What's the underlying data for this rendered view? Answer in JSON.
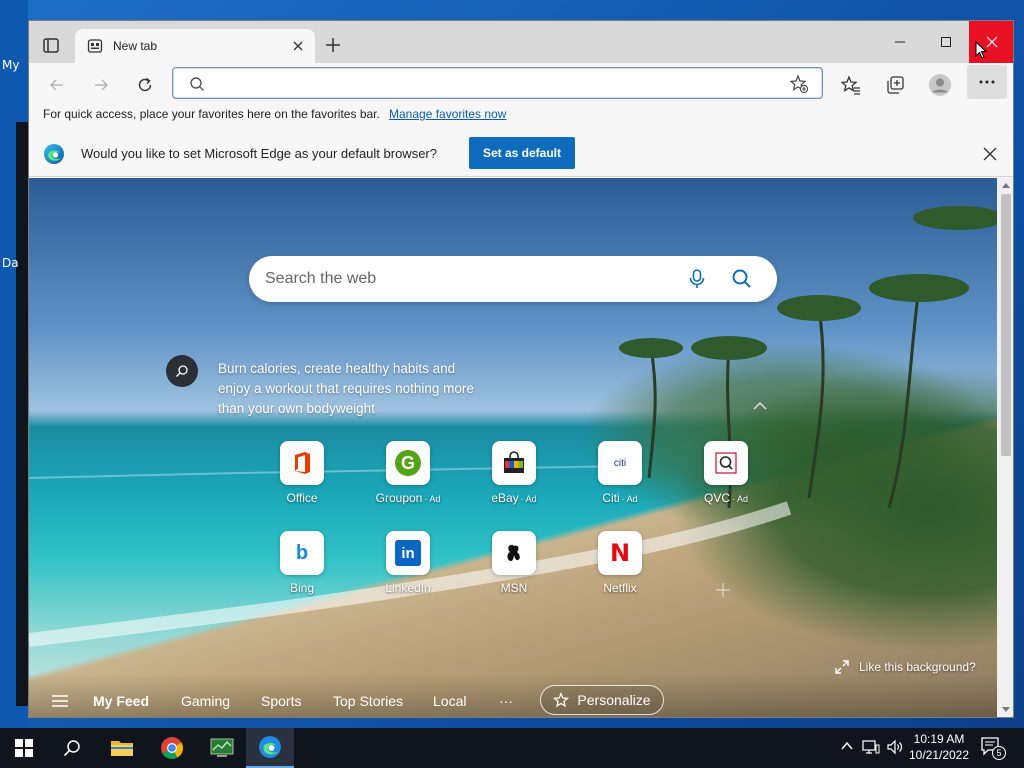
{
  "desktop": {
    "icon_labels": [
      "My",
      "Da"
    ]
  },
  "browser": {
    "tab": {
      "title": "New tab"
    },
    "address_bar": {
      "value": "",
      "placeholder": ""
    },
    "favorites_bar": {
      "text": "For quick access, place your favorites here on the favorites bar.",
      "link": "Manage favorites now"
    },
    "infobar": {
      "message": "Would you like to set Microsoft Edge as your default browser?",
      "button": "Set as default"
    }
  },
  "newtab": {
    "search_placeholder": "Search the web",
    "tip": "Burn calories, create healthy habits and enjoy a workout that requires nothing more than your own bodyweight",
    "quick_links": [
      {
        "label": "Office",
        "ad": ""
      },
      {
        "label": "Groupon",
        "ad": "· Ad"
      },
      {
        "label": "eBay",
        "ad": "· Ad"
      },
      {
        "label": "Citi",
        "ad": "· Ad"
      },
      {
        "label": "QVC",
        "ad": "· Ad"
      },
      {
        "label": "Bing",
        "ad": ""
      },
      {
        "label": "LinkedIn",
        "ad": ""
      },
      {
        "label": "MSN",
        "ad": ""
      },
      {
        "label": "Netflix",
        "ad": ""
      }
    ],
    "tile_glyphs": {
      "citi": "citi",
      "groupon": "G",
      "netflix": "N",
      "bing": "b",
      "linkedin": "in"
    },
    "like_background": "Like this background?",
    "feed_tabs": [
      "My Feed",
      "Gaming",
      "Sports",
      "Top Stories",
      "Local"
    ],
    "more": "···",
    "personalize": "Personalize"
  },
  "taskbar": {
    "time": "10:19 AM",
    "date": "10/21/2022",
    "notification_count": "5"
  },
  "colors": {
    "accent": "#0f6cbd",
    "close_red": "#e81123",
    "taskbar": "#10151d"
  }
}
